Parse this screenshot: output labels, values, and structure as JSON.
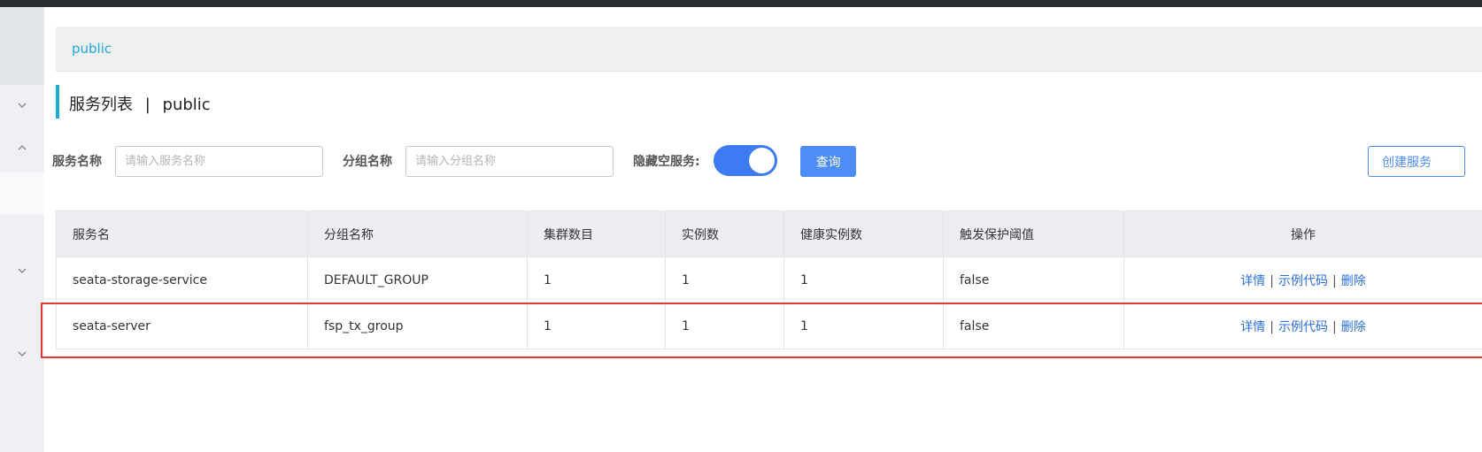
{
  "namespace": {
    "label": "public"
  },
  "page": {
    "title": "服务列表",
    "separator": "|",
    "namespace": "public"
  },
  "filters": {
    "service_name_label": "服务名称",
    "service_name_placeholder": "请输入服务名称",
    "group_name_label": "分组名称",
    "group_name_placeholder": "请输入分组名称",
    "hide_empty_label": "隐藏空服务:",
    "hide_empty_enabled": true,
    "query_label": "查询",
    "create_label": "创建服务"
  },
  "table": {
    "columns": [
      "服务名",
      "分组名称",
      "集群数目",
      "实例数",
      "健康实例数",
      "触发保护阈值",
      "操作"
    ],
    "rows": [
      {
        "service": "seata-storage-service",
        "group": "DEFAULT_GROUP",
        "clusters": "1",
        "instances": "1",
        "healthy": "1",
        "protect": "false"
      },
      {
        "service": "seata-server",
        "group": "fsp_tx_group",
        "clusters": "1",
        "instances": "1",
        "healthy": "1",
        "protect": "false"
      }
    ],
    "actions": {
      "detail": "详情",
      "sample_code": "示例代码",
      "delete": "删除",
      "sep": "|"
    }
  },
  "colors": {
    "accent": "#1fa9d9",
    "primary": "#4d8df7",
    "toggle": "#3d7bf2",
    "highlight": "#e53935"
  },
  "icons": {
    "sidebar_chevrons": [
      "chevron-down-icon",
      "chevron-up-icon",
      "chevron-down-icon",
      "chevron-down-icon"
    ]
  }
}
